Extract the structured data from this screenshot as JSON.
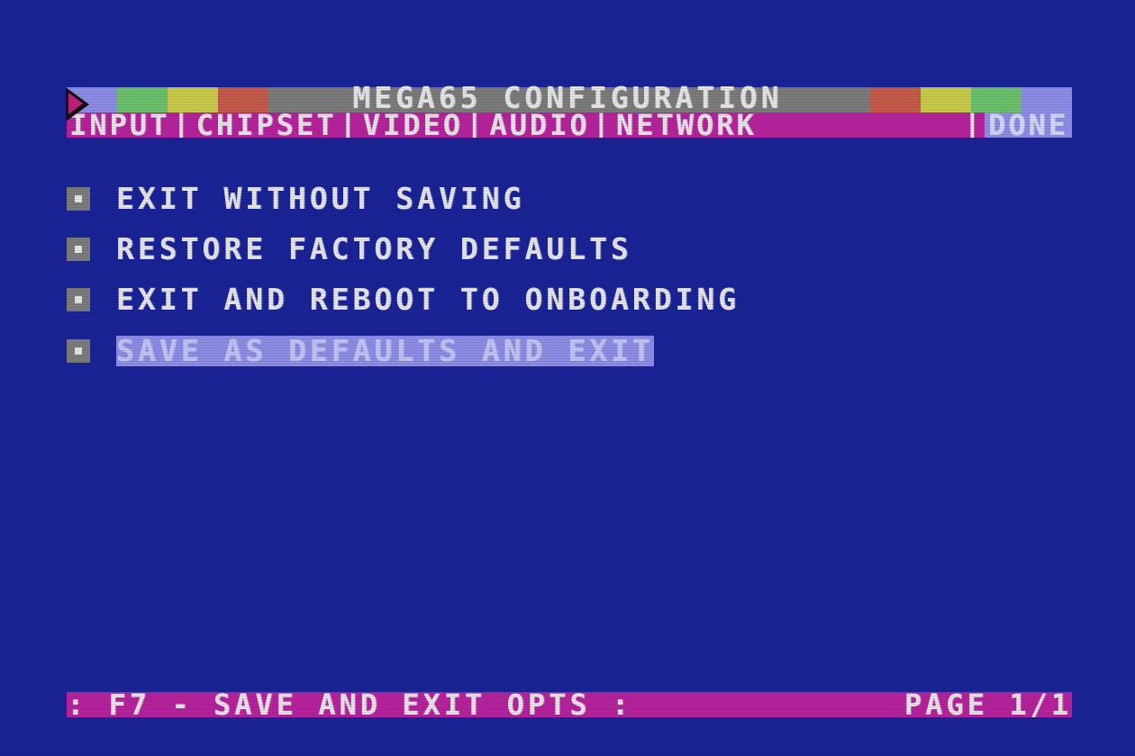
{
  "title_bar": {
    "text": "MEGA65 CONFIGURATION",
    "stripe_colors_left": [
      "#8c8ce4",
      "#6ac06a",
      "#c8c84a",
      "#c45a4a"
    ],
    "stripe_colors_right": [
      "#c45a4a",
      "#c8c84a",
      "#6ac06a",
      "#8c8ce4"
    ]
  },
  "tabs": [
    {
      "label": "INPUT"
    },
    {
      "label": "CHIPSET"
    },
    {
      "label": "VIDEO"
    },
    {
      "label": "AUDIO"
    },
    {
      "label": "NETWORK"
    }
  ],
  "tab_separator": "|",
  "done_tab": {
    "label": "DONE",
    "selected": true
  },
  "menu": {
    "bullet_icon": "square-bullet-icon",
    "items": [
      {
        "label": "EXIT WITHOUT SAVING",
        "selected": false
      },
      {
        "label": "RESTORE FACTORY DEFAULTS",
        "selected": false
      },
      {
        "label": "EXIT AND REBOOT TO ONBOARDING",
        "selected": false
      },
      {
        "label": "SAVE AS DEFAULTS AND EXIT",
        "selected": true
      }
    ]
  },
  "status_bar": {
    "help": ": F7 - SAVE AND EXIT OPTS :",
    "page": "PAGE 1/1"
  },
  "colors": {
    "background": "#1a2396",
    "bar_magenta": "#b4239c",
    "highlight": "#8c8ce4",
    "text": "#e4e4e4",
    "title_grey": "#7b7b7b"
  }
}
